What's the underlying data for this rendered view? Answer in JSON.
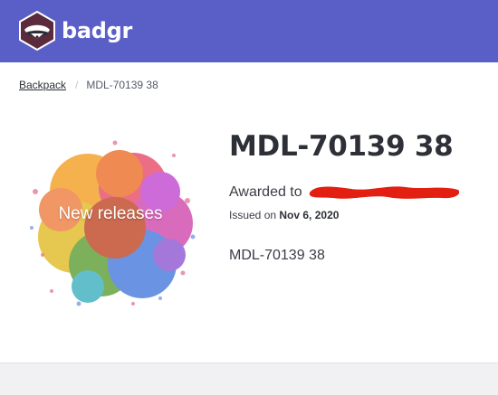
{
  "brand": {
    "name": "badgr",
    "color": "#5a5fc7",
    "logo_icon": "badger-shield-icon"
  },
  "breadcrumb": {
    "parent": "Backpack",
    "current": "MDL-70139 38"
  },
  "badge": {
    "image_caption": "New releases",
    "title": "MDL-70139 38",
    "awarded_prefix": "Awarded to",
    "issued_prefix": "Issued on",
    "issued_date": "Nov 6, 2020",
    "description": "MDL-70139 38"
  }
}
